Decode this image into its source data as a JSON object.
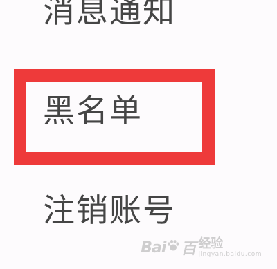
{
  "menu": {
    "items": [
      {
        "label": "消息通知"
      },
      {
        "label": "黑名单"
      },
      {
        "label": "注销账号"
      }
    ],
    "highlight_color": "#ee3a3a",
    "text_color": "#454545",
    "background_color": "#fdfbfd"
  },
  "watermark": {
    "logo_text": "Bai",
    "logo_text_end": "百",
    "cn_text": "经验",
    "url": "jingyan.baidu.com"
  }
}
